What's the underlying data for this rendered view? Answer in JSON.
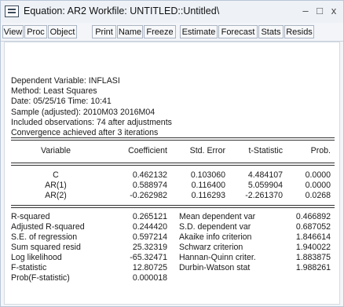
{
  "window": {
    "title": "Equation: AR2   Workfile: UNTITLED::Untitled\\",
    "minimize_glyph": "–",
    "maximize_glyph": "□",
    "close_glyph": "x"
  },
  "toolbar": {
    "buttons": [
      "View",
      "Proc",
      "Object",
      "Print",
      "Name",
      "Freeze",
      "Estimate",
      "Forecast",
      "Stats",
      "Resids"
    ]
  },
  "header": {
    "lines": [
      "Dependent Variable: INFLASI",
      "Method: Least Squares",
      "Date: 05/25/16   Time: 10:41",
      "Sample (adjusted): 2010M03 2016M04",
      "Included observations: 74 after adjustments",
      "Convergence achieved after 3 iterations"
    ]
  },
  "coef_table": {
    "columns": [
      "Variable",
      "Coefficient",
      "Std. Error",
      "t-Statistic",
      "Prob."
    ],
    "rows": [
      [
        "C",
        "0.462132",
        "0.103060",
        "4.484107",
        "0.0000"
      ],
      [
        "AR(1)",
        "0.588974",
        "0.116400",
        "5.059904",
        "0.0000"
      ],
      [
        "AR(2)",
        "-0.262982",
        "0.116293",
        "-2.261370",
        "0.0268"
      ]
    ]
  },
  "stats": {
    "left": [
      [
        "R-squared",
        "0.265121"
      ],
      [
        "Adjusted R-squared",
        "0.244420"
      ],
      [
        "S.E. of regression",
        "0.597214"
      ],
      [
        "Sum squared resid",
        "25.32319"
      ],
      [
        "Log likelihood",
        "-65.32471"
      ],
      [
        "F-statistic",
        "12.80725"
      ],
      [
        "Prob(F-statistic)",
        "0.000018"
      ]
    ],
    "right": [
      [
        "Mean dependent var",
        "0.466892"
      ],
      [
        "S.D. dependent var",
        "0.687052"
      ],
      [
        "Akaike info criterion",
        "1.846614"
      ],
      [
        "Schwarz criterion",
        "1.940022"
      ],
      [
        "Hannan-Quinn criter.",
        "1.883875"
      ],
      [
        "Durbin-Watson stat",
        "1.988261"
      ]
    ]
  }
}
